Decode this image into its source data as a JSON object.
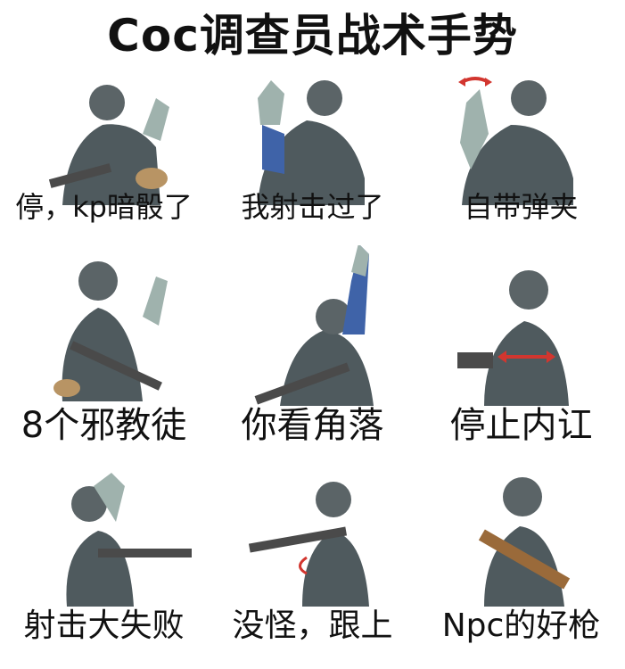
{
  "title": "Coc调查员战术手势",
  "gestures": [
    {
      "caption": "停，kp暗骰了"
    },
    {
      "caption": "我射击过了"
    },
    {
      "caption": "自带弹夹"
    },
    {
      "caption": "8个邪教徒"
    },
    {
      "caption": "你看角落"
    },
    {
      "caption": "停止内讧"
    },
    {
      "caption": "射击大失败"
    },
    {
      "caption": "没怪，跟上"
    },
    {
      "caption": "Npc的好枪"
    }
  ],
  "colors": {
    "helmet": "#5b6467",
    "vest": "#4f5a5e",
    "sleeve": "#3f63a8",
    "glove": "#9fb2ad",
    "gun": "#4a4a4a",
    "wood": "#9a6a3a",
    "arrow": "#d2362f"
  }
}
